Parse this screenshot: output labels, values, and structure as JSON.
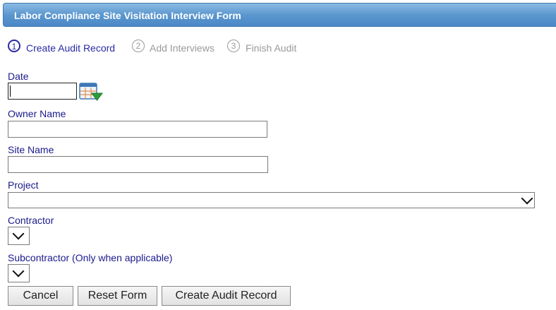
{
  "form": {
    "title": "Labor Compliance Site Visitation Interview Form"
  },
  "steps": [
    {
      "number": "1",
      "label": "Create Audit Record",
      "state": "active"
    },
    {
      "number": "2",
      "label": "Add Interviews",
      "state": "inactive"
    },
    {
      "number": "3",
      "label": "Finish Audit",
      "state": "inactive"
    }
  ],
  "fields": {
    "date": {
      "label": "Date",
      "value": ""
    },
    "owner_name": {
      "label": "Owner Name",
      "value": ""
    },
    "site_name": {
      "label": "Site Name",
      "value": ""
    },
    "project": {
      "label": "Project",
      "selected": ""
    },
    "contractor": {
      "label": "Contractor",
      "selected": ""
    },
    "subcontractor": {
      "label": "Subcontractor (Only when applicable)",
      "selected": ""
    }
  },
  "buttons": {
    "cancel": "Cancel",
    "reset": "Reset Form",
    "create": "Create Audit Record"
  },
  "icons": {
    "calendar": "calendar-dropdown-icon",
    "select_arrow": "chevron-down-icon"
  },
  "colors": {
    "title_bar": "#5b97cf",
    "label_text": "#1a1a8c",
    "active_step": "#2a2aa6",
    "inactive_step": "#9a9a9a"
  }
}
